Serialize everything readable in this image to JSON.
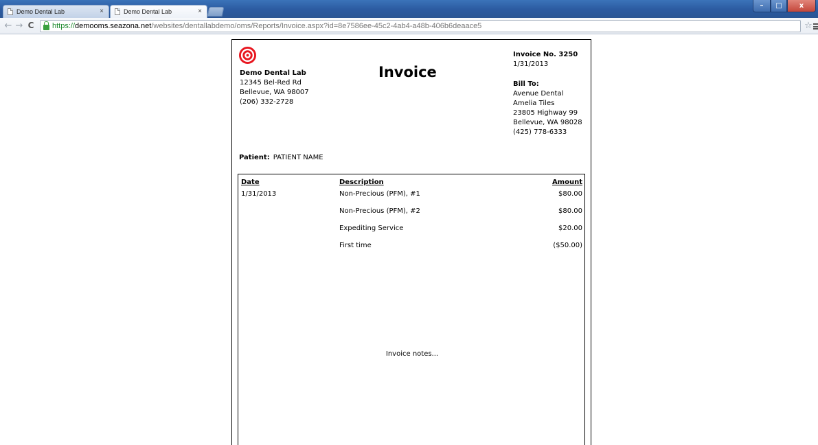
{
  "browser": {
    "tabs": [
      {
        "title": "Demo Dental Lab",
        "active": false
      },
      {
        "title": "Demo Dental Lab",
        "active": true
      }
    ],
    "close_glyph": "×",
    "url": {
      "scheme": "https://",
      "host": "demooms.seazona.net",
      "path": "/websites/dentallabdemo/oms/Reports/Invoice.aspx?id=8e7586ee-45c2-4ab4-a48b-406b6deaace5"
    },
    "icons": {
      "back": "←",
      "forward": "→",
      "reload": "C",
      "star": "☆",
      "minimize": "–",
      "maximize": "□",
      "close": "x"
    }
  },
  "invoice": {
    "logo_color": "#e8161f",
    "lab": {
      "name": "Demo Dental Lab",
      "address1": "12345 Bel-Red Rd",
      "address2": "Bellevue, WA 98007",
      "phone": "(206) 332-2728"
    },
    "title": "Invoice",
    "number_label": "Invoice No. 3250",
    "date": "1/31/2013",
    "bill_to": {
      "label": "Bill To:",
      "lines": [
        "Avenue Dental",
        "Amelia Tiles",
        "23805 Highway 99",
        "Bellevue, WA 98028",
        "(425) 778-6333"
      ]
    },
    "patient": {
      "label": "Patient:",
      "name": "PATIENT NAME"
    },
    "columns": {
      "date": "Date",
      "description": "Description",
      "amount": "Amount"
    },
    "items": [
      {
        "date": "1/31/2013",
        "description": "Non-Precious (PFM), #1",
        "amount": "$80.00"
      },
      {
        "date": "",
        "description": "Non-Precious (PFM), #2",
        "amount": "$80.00"
      },
      {
        "date": "",
        "description": "Expediting Service",
        "amount": "$20.00"
      },
      {
        "date": "",
        "description": "First time",
        "amount": "($50.00)"
      }
    ],
    "notes": "Invoice notes..."
  }
}
